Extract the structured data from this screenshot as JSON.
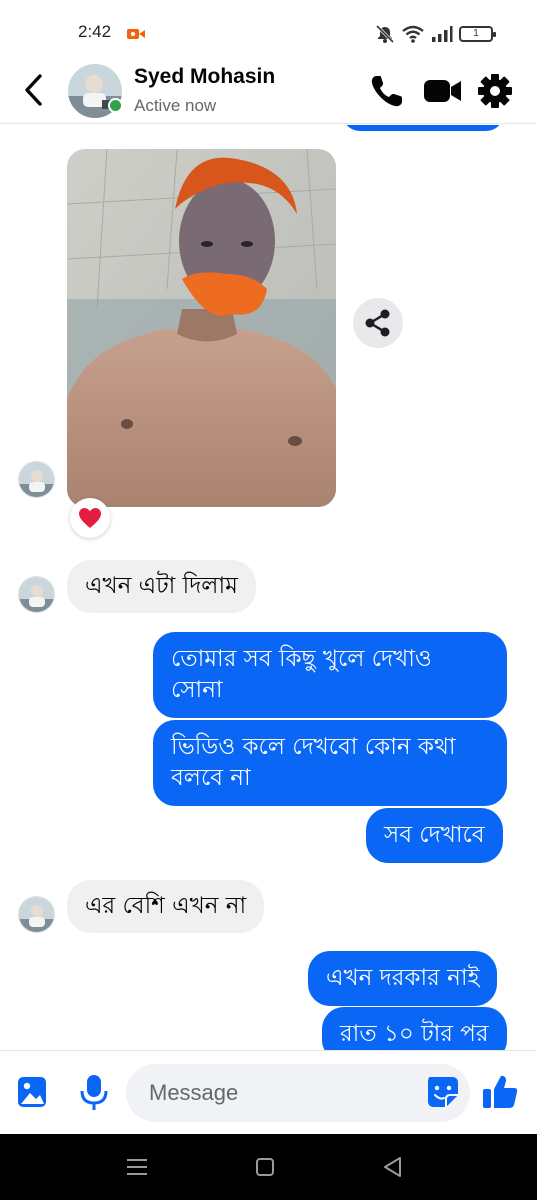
{
  "status_bar": {
    "time": "2:42",
    "battery": "1"
  },
  "header": {
    "contact_name": "Syed Mohasin",
    "status": "Active now"
  },
  "messages": {
    "in_1": "এখন এটা দিলাম",
    "out_1": "তোমার সব কিছু খুলে দেখাও সোনা",
    "out_2": "ভিডিও কলে দেখবো কোন কথা বলবে না",
    "out_3": "সব দেখাবে",
    "in_2": "এর বেশি এখন না",
    "out_4": "এখন দরকার নাই",
    "out_5": "রাত ১০ টার পর"
  },
  "reaction": "heart",
  "composer": {
    "placeholder": "Message"
  },
  "colors": {
    "accent": "#0a66f5",
    "incoming_bubble": "#f0f0f0",
    "online": "#31a24c",
    "reaction": "#e41e3f"
  },
  "icons": {
    "back": "chevron-left-icon",
    "call": "phone-icon",
    "video": "video-camera-icon",
    "settings": "gear-icon",
    "share": "share-icon",
    "gallery": "image-icon",
    "mic": "microphone-icon",
    "sticker": "sticker-icon",
    "like": "thumbs-up-icon"
  }
}
